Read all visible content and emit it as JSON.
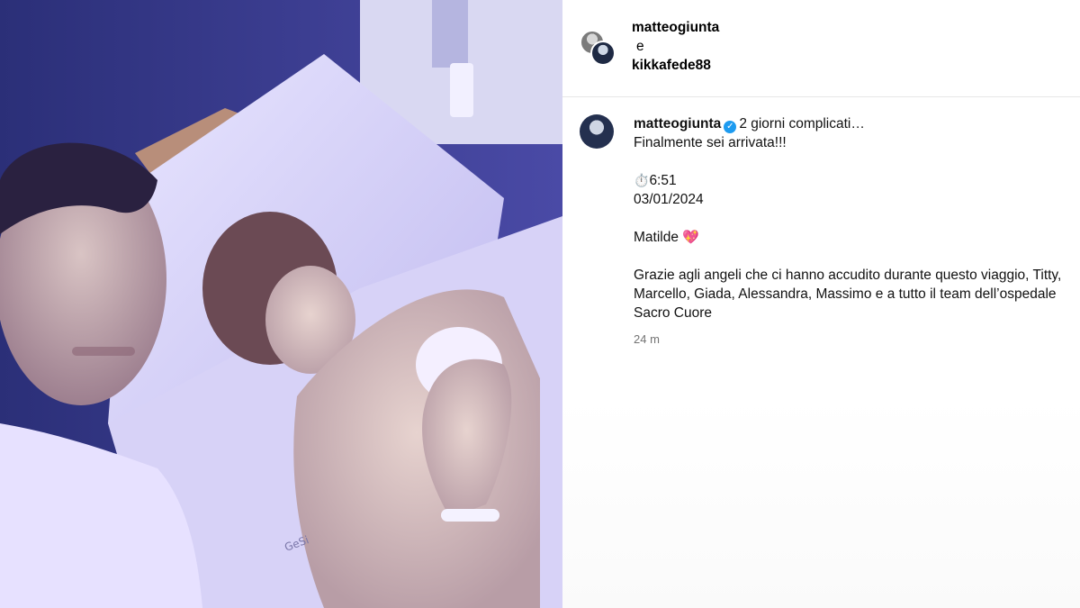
{
  "header": {
    "user1": "matteogiunta",
    "conjunction": "e",
    "user2": "kikkafede88"
  },
  "caption": {
    "username": "matteogiunta",
    "verified_icon": "verified-badge-icon",
    "line1": "2 giorni complicati…",
    "line2": "Finalmente sei arrivata!!!",
    "time_icon": "⏱️",
    "time": "6:51",
    "date": "03/01/2024",
    "name": "Matilde",
    "heart_icon": "💖",
    "thanks": "Grazie agli angeli che ci hanno accudito durante questo viaggio, Titty, Marcello, Giada, Alessandra, Massimo e a tutto il team dell’ospedale Sacro Cuore",
    "ago": "24 m"
  },
  "photo": {
    "description_icon": "photo-image",
    "tag_text": "GeSi"
  },
  "colors": {
    "accent": "#1d9bf0",
    "muted": "#737373",
    "divider": "#e6e6e6"
  }
}
